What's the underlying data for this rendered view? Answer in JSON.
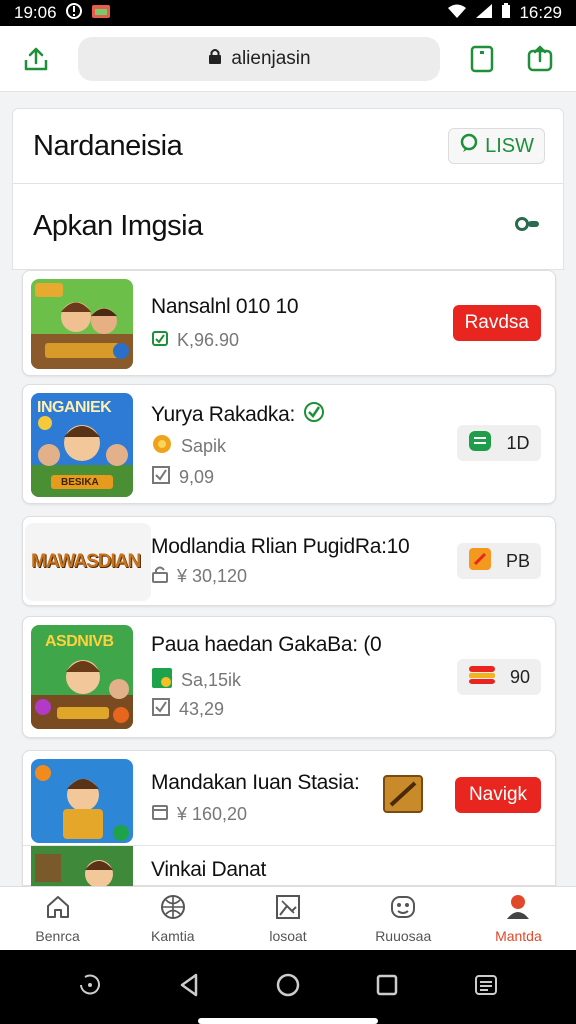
{
  "status_bar": {
    "time_left": "19:06",
    "time_right": "16:29"
  },
  "browser": {
    "url": "alienjasin"
  },
  "header": {
    "title": "Nardaneisia",
    "badge_label": "LISW"
  },
  "section": {
    "title": "Apkan Imgsia"
  },
  "apps": [
    {
      "title": "Nansalnl 010   10",
      "line1": "K,96.90",
      "button": "Ravdsa"
    },
    {
      "title": "Yurya Rakadka:",
      "line1": "Sapik",
      "line2": "9,09",
      "button": "1D",
      "thumb_text": "INGANIEK",
      "thumb_bottom": "BESIKA"
    },
    {
      "title": "Modlandia Rlian PugidRa:10",
      "line1": "¥ 30,120",
      "button": "PB",
      "thumb_text": "MAWASDIAN"
    },
    {
      "title": "Paua haedan GakaBa: (0",
      "line1": "Sa,15ik",
      "line2": "43,29",
      "button": "90",
      "thumb_text": "ASDNIVB"
    },
    {
      "title": "Mandakan Iuan Stasia:",
      "line1": "¥ 160,20",
      "button": "Navigk"
    },
    {
      "title": "Vinkai Danat"
    }
  ],
  "bottom_nav": [
    {
      "label": "Benrca",
      "icon": "home-icon"
    },
    {
      "label": "Kamtia",
      "icon": "globe-icon"
    },
    {
      "label": "losoat",
      "icon": "image-icon"
    },
    {
      "label": "Ruuosaa",
      "icon": "face-icon"
    },
    {
      "label": "Mantda",
      "icon": "profile-icon",
      "active": true
    }
  ],
  "colors": {
    "accent_green": "#1f8f3a",
    "accent_red": "#e8261f",
    "active_nav": "#e0492a"
  }
}
